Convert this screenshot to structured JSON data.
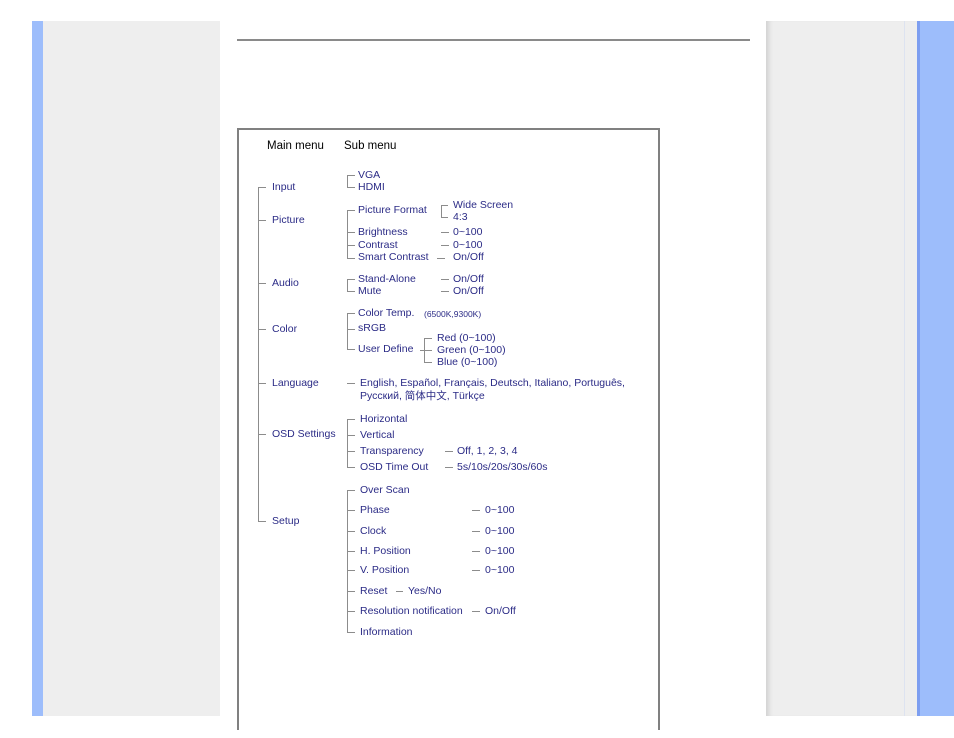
{
  "page": {
    "colors": {
      "accent_blue": "#9dbdfb",
      "panel_gray": "#eeeeee",
      "text_navy": "#2b2b86",
      "frame_gray": "#808080"
    }
  },
  "diagram": {
    "headers": {
      "main": "Main menu",
      "sub": "Sub menu"
    },
    "menus": {
      "input": {
        "label": "Input",
        "items": [
          "VGA",
          "HDMI"
        ]
      },
      "picture": {
        "label": "Picture",
        "picture_format": {
          "label": "Picture Format",
          "options": [
            "Wide Screen",
            "4:3"
          ]
        },
        "brightness": {
          "label": "Brightness",
          "value": "0~100"
        },
        "contrast": {
          "label": "Contrast",
          "value": "0~100"
        },
        "smart_contrast": {
          "label": "Smart Contrast",
          "value": "On/Off"
        }
      },
      "audio": {
        "label": "Audio",
        "stand_alone": {
          "label": "Stand-Alone",
          "value": "On/Off"
        },
        "mute": {
          "label": "Mute",
          "value": "On/Off"
        }
      },
      "color": {
        "label": "Color",
        "color_temp": {
          "label": "Color Temp.",
          "value": "(6500K,9300K)"
        },
        "srgb": {
          "label": "sRGB"
        },
        "user_define": {
          "label": "User Define",
          "options": [
            "Red (0~100)",
            "Green (0~100)",
            "Blue (0~100)"
          ]
        }
      },
      "language": {
        "label": "Language",
        "line1": "English, Español, Français, Deutsch, Italiano, Português,",
        "line2": "Русский, 简体中文, Türkçe"
      },
      "osd": {
        "label": "OSD Settings",
        "horizontal": {
          "label": "Horizontal"
        },
        "vertical": {
          "label": "Vertical"
        },
        "transparency": {
          "label": "Transparency",
          "value": "Off, 1, 2, 3, 4"
        },
        "timeout": {
          "label": "OSD Time Out",
          "value": "5s/10s/20s/30s/60s"
        }
      },
      "setup": {
        "label": "Setup",
        "over_scan": {
          "label": "Over Scan"
        },
        "phase": {
          "label": "Phase",
          "value": "0~100"
        },
        "clock": {
          "label": "Clock",
          "value": "0~100"
        },
        "h_position": {
          "label": "H. Position",
          "value": "0~100"
        },
        "v_position": {
          "label": "V. Position",
          "value": "0~100"
        },
        "reset": {
          "label": "Reset",
          "value": "Yes/No"
        },
        "resolution_notification": {
          "label": "Resolution notification",
          "value": "On/Off"
        },
        "information": {
          "label": "Information"
        }
      }
    }
  }
}
